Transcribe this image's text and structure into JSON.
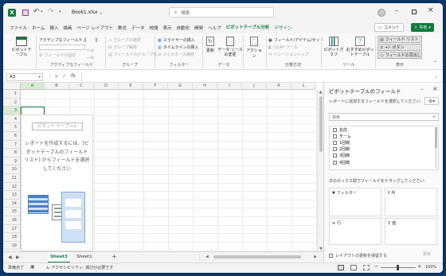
{
  "title_bar": {
    "autosave_label": "",
    "filename": "Book1.xlsx",
    "search_placeholder": "検索"
  },
  "ribbon_tabs": [
    "ファイル",
    "ホーム",
    "挿入",
    "描画",
    "ページ レイアウト",
    "数式",
    "データ",
    "校閲",
    "表示",
    "自動化",
    "開発",
    "ヘルプ",
    "ピボットテーブル分析",
    "デザイン"
  ],
  "ribbon_tabs_active": "ピボットテーブル分析",
  "comment_button": "コメント",
  "share_button": "共有",
  "ribbon": {
    "pivot_table_label": "ピボットテーブル",
    "active_field": {
      "field_label": "アクティブなフィールド:",
      "drill_down": "ドリルダウン",
      "drill_up": "ドリルアップ",
      "field_settings": "フィールドの設定",
      "group_name": "アクティブなフィールド"
    },
    "group": {
      "selection": "グループの選択",
      "ungroup": "グループ解除",
      "group_field": "フィールドのグループ化",
      "group_name": "グループ"
    },
    "filter": {
      "insert_slicer": "スライサーの挿入",
      "insert_timeline": "タイムラインの挿入",
      "filter_connections": "フィルターの接続",
      "group_name": "フィルター"
    },
    "data": {
      "refresh": "更新",
      "change_source": "データ ソースの変更",
      "group_name": "データ"
    },
    "actions": {
      "label": "アクション"
    },
    "calculations": {
      "fields_items_sets": "フィールド/アイテム/セット",
      "olap_tools": "OLAP ツール",
      "relationships": "リレーションシップ",
      "group_name": "計算方法"
    },
    "tools": {
      "pivot_chart": "ピボットグラフ",
      "recommended": "おすすめピボットテーブル",
      "group_name": "ツール"
    },
    "show": {
      "field_list": "フィールド リスト",
      "buttons": "+/- ボタン",
      "field_headers": "フィールドの見出し",
      "group_name": "表示"
    }
  },
  "formula_bar": {
    "name_box": "A3",
    "fx": "fx",
    "formula": ""
  },
  "columns": [
    "A",
    "B",
    "C",
    "D",
    "E",
    "F",
    "G",
    "H",
    "I",
    "J",
    "K",
    "L"
  ],
  "rows": [
    "1",
    "2",
    "3",
    "4",
    "5",
    "6",
    "7",
    "8",
    "9",
    "10",
    "11",
    "12",
    "13",
    "14",
    "15",
    "16",
    "17",
    "18",
    "19"
  ],
  "pivot_placeholder": {
    "title": "ピボット テーブル2",
    "instructions": "レポートを作成するには、[ピボットテーブルのフィールド リスト] からフィールドを選択してください"
  },
  "sheets": [
    "Sheet3",
    "Sheet1"
  ],
  "active_sheet": "Sheet3",
  "field_panel": {
    "title": "ピボットテーブルのフィールド",
    "subtitle": "レポートに追加するフィールドを選択してください:",
    "search_placeholder": "検索",
    "fields": [
      "名前",
      "チーム",
      "1回戦",
      "2回戦",
      "3回戦",
      "4回戦"
    ],
    "drag_hint": "次のボックス間でフィールドをドラッグしてください:",
    "areas": {
      "filter": "フィルター",
      "columns": "列",
      "rows": "行",
      "values": "値"
    },
    "defer_label": "レイアウトの更新を保留する",
    "update_button": "更新"
  },
  "status_bar": {
    "ready": "準備完了",
    "accessibility": "アクセシビリティ: 検討が必要です",
    "zoom": "100%"
  },
  "colors": {
    "excel_green": "#127a3e",
    "accent": "#1f6fd1"
  }
}
